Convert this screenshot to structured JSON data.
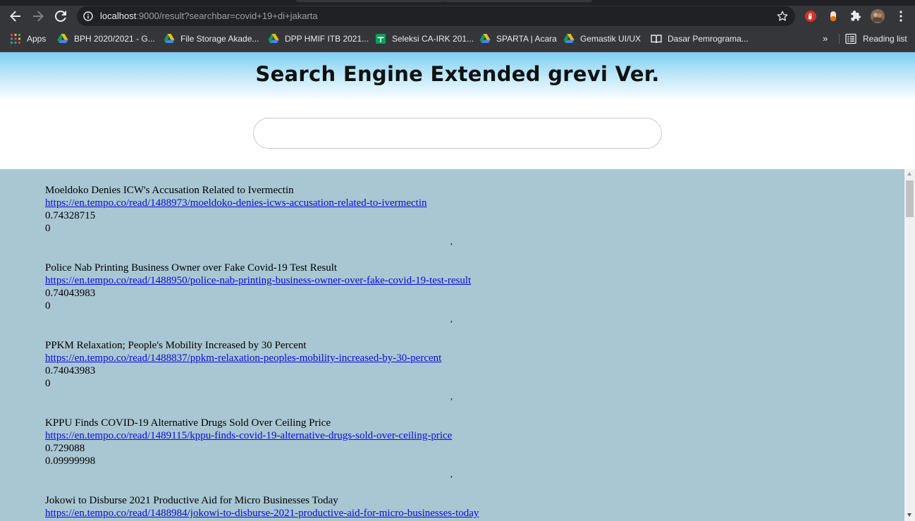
{
  "browser": {
    "url_host": "localhost",
    "url_rest": ":9000/result?searchbar=covid+19+di+jakarta",
    "bookmarks": [
      {
        "label": "Apps",
        "icon": "apps-grid-icon"
      },
      {
        "label": "BPH 2020/2021 - G...",
        "icon": "google-drive-icon"
      },
      {
        "label": "File Storage Akade...",
        "icon": "google-drive-icon"
      },
      {
        "label": "DPP HMIF ITB 2021...",
        "icon": "google-drive-icon"
      },
      {
        "label": "Seleksi CA-IRK 201...",
        "icon": "google-sheets-icon"
      },
      {
        "label": "SPARTA | Acara",
        "icon": "google-drive-icon"
      },
      {
        "label": "Gemastik UI/UX",
        "icon": "google-drive-icon"
      },
      {
        "label": "Dasar Pemrograma...",
        "icon": "book-icon"
      }
    ],
    "overflow": "»",
    "reading_list": "Reading list"
  },
  "page": {
    "title": "Search Engine Extended grevi Ver.",
    "search_value": ""
  },
  "results": [
    {
      "title": "Moeldoko Denies ICW's Accusation Related to Ivermectin",
      "url": "https://en.tempo.co/read/1488973/moeldoko-denies-icws-accusation-related-to-ivermectin",
      "score": "0.74328715",
      "extra": "0"
    },
    {
      "title": "Police Nab Printing Business Owner over Fake Covid-19 Test Result",
      "url": "https://en.tempo.co/read/1488950/police-nab-printing-business-owner-over-fake-covid-19-test-result",
      "score": "0.74043983",
      "extra": "0"
    },
    {
      "title": "PPKM Relaxation; People's Mobility Increased by 30 Percent",
      "url": "https://en.tempo.co/read/1488837/ppkm-relaxation-peoples-mobility-increased-by-30-percent",
      "score": "0.74043983",
      "extra": "0"
    },
    {
      "title": "KPPU Finds COVID-19 Alternative Drugs Sold Over Ceiling Price",
      "url": "https://en.tempo.co/read/1489115/kppu-finds-covid-19-alternative-drugs-sold-over-ceiling-price",
      "score": "0.729088",
      "extra": "0.09999998"
    },
    {
      "title": "Jokowi to Disburse 2021 Productive Aid for Micro Businesses Today",
      "url": "https://en.tempo.co/read/1488984/jokowi-to-disburse-2021-productive-aid-for-micro-businesses-today",
      "score": "",
      "extra": ""
    }
  ],
  "separator": ","
}
